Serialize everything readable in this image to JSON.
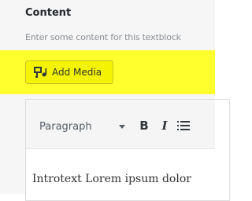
{
  "field": {
    "title": "Content",
    "description": "Enter some content for this textblock"
  },
  "media_button": {
    "label": "Add Media",
    "icon": "add-media-icon"
  },
  "toolbar": {
    "format_select": {
      "value": "Paragraph"
    },
    "bold_label": "B",
    "italic_label": "I",
    "list_icon": "bullet-list-icon"
  },
  "editor": {
    "content": "Introtext Lorem ipsum dolor"
  },
  "colors": {
    "highlight": "#ffff2e",
    "panel_background": "#f6f6f6",
    "toolbar_background": "#f5f5f5",
    "editor_background": "#ffffff"
  }
}
